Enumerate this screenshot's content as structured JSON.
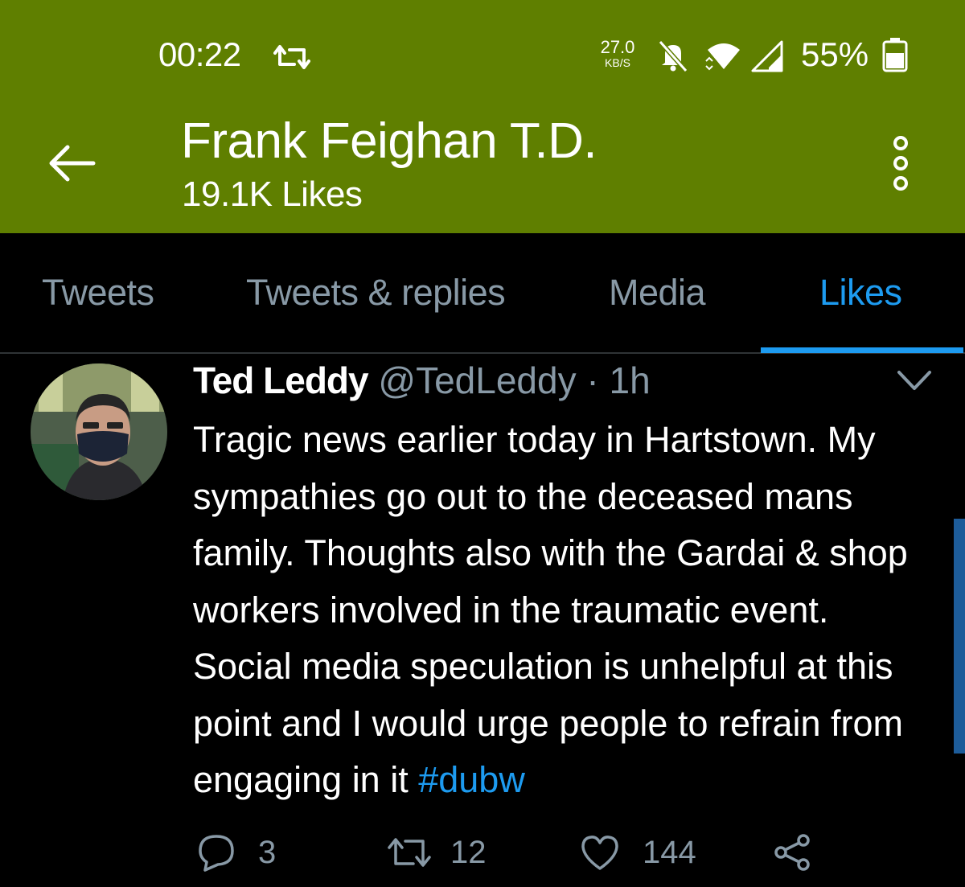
{
  "status_bar": {
    "time": "00:22",
    "net_speed_value": "27.0",
    "net_speed_unit": "KB/S",
    "battery": "55%",
    "icons": [
      "retweet-notification-icon",
      "bell-off-icon",
      "wifi-icon",
      "signal-icon",
      "battery-icon"
    ]
  },
  "app_bar": {
    "profile_name": "Frank Feighan T.D.",
    "likes_count": "19.1K Likes",
    "background": "#5f7f00"
  },
  "tabs": [
    {
      "label": "Tweets",
      "active": false
    },
    {
      "label": "Tweets & replies",
      "active": false
    },
    {
      "label": "Media",
      "active": false
    },
    {
      "label": "Likes",
      "active": true
    }
  ],
  "tweet": {
    "author": "Ted Leddy",
    "handle": "@TedLeddy",
    "separator": "·",
    "time": "1h",
    "lines": [
      "Tragic news earlier today in Hartstown. My",
      "sympathies go out to the deceased mans",
      "family. Thoughts also with the Gardai & shop",
      "workers involved in the traumatic event.",
      "Social media speculation is unhelpful at this",
      "point and I would urge people to refrain from",
      "engaging in it "
    ],
    "hashtag": "#dubw",
    "replies": "3",
    "retweets": "12",
    "likes": "144"
  },
  "colors": {
    "accent": "#1d9bf0",
    "muted_text": "#8899a6",
    "background": "#000000"
  }
}
